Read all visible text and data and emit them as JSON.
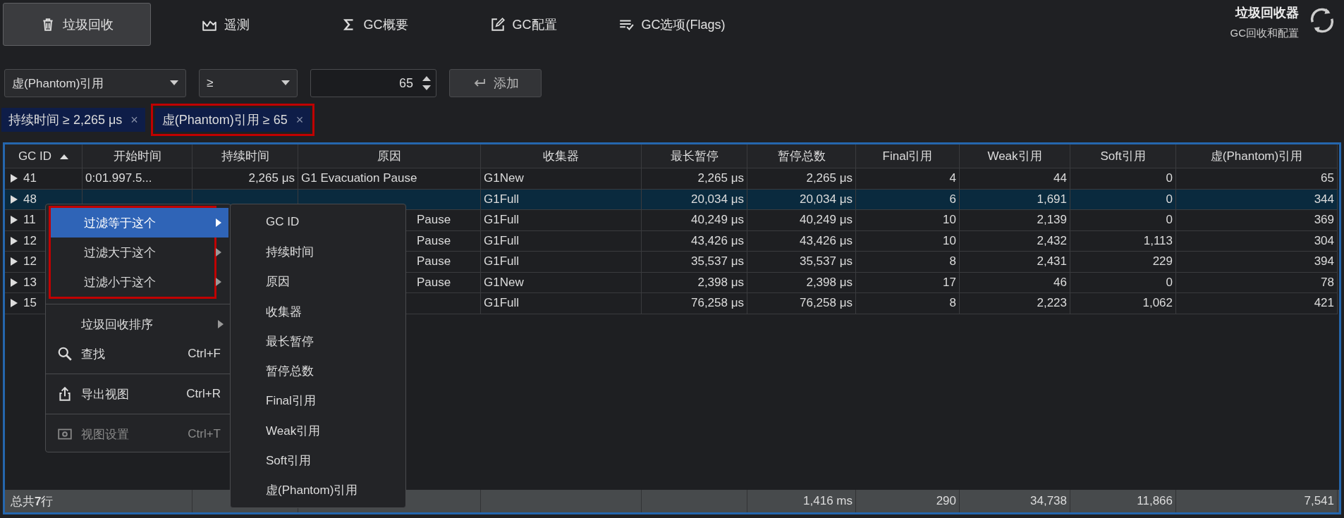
{
  "toolbar": {
    "tabs": [
      {
        "label": "垃圾回收",
        "selected": true
      },
      {
        "label": "遥测",
        "selected": false
      },
      {
        "label": "GC概要",
        "selected": false
      },
      {
        "label": "GC配置",
        "selected": false
      },
      {
        "label": "GC选项(Flags)",
        "selected": false
      }
    ],
    "title": "垃圾回收器",
    "subtitle": "GC回收和配置"
  },
  "filter": {
    "field": "虚(Phantom)引用",
    "operator": "≥",
    "value": "65",
    "add_button": "添加"
  },
  "chips": [
    {
      "label": "持续时间 ≥ 2,265 μs",
      "remove": "×",
      "annotated": false
    },
    {
      "label": "虚(Phantom)引用 ≥ 65",
      "remove": "×",
      "annotated": true
    }
  ],
  "table": {
    "columns": [
      "GC ID",
      "开始时间",
      "持续时间",
      "原因",
      "收集器",
      "最长暂停",
      "暂停总数",
      "Final引用",
      "Weak引用",
      "Soft引用",
      "虚(Phantom)引用"
    ],
    "rows": [
      {
        "selected": false,
        "reason_clipped": false,
        "cells": [
          "41",
          "0:01.997.5...",
          "2,265 μs",
          "G1 Evacuation Pause",
          "G1New",
          "2,265 μs",
          "2,265 μs",
          "4",
          "44",
          "0",
          "65"
        ]
      },
      {
        "selected": true,
        "reason_clipped": false,
        "cells": [
          "48",
          null,
          null,
          null,
          "G1Full",
          "20,034 μs",
          "20,034 μs",
          "6",
          "1,691",
          "0",
          "344"
        ]
      },
      {
        "selected": false,
        "reason_clipped": true,
        "cells": [
          "11",
          null,
          null,
          "Pause",
          "G1Full",
          "40,249 μs",
          "40,249 μs",
          "10",
          "2,139",
          "0",
          "369"
        ]
      },
      {
        "selected": false,
        "reason_clipped": true,
        "cells": [
          "12",
          null,
          null,
          "Pause",
          "G1Full",
          "43,426 μs",
          "43,426 μs",
          "10",
          "2,432",
          "1,113",
          "304"
        ]
      },
      {
        "selected": false,
        "reason_clipped": true,
        "cells": [
          "12",
          null,
          null,
          "Pause",
          "G1Full",
          "35,537 μs",
          "35,537 μs",
          "8",
          "2,431",
          "229",
          "394"
        ]
      },
      {
        "selected": false,
        "reason_clipped": true,
        "cells": [
          "13",
          null,
          null,
          "Pause",
          "G1New",
          "2,398 μs",
          "2,398 μs",
          "17",
          "46",
          "0",
          "78"
        ]
      },
      {
        "selected": false,
        "cells": [
          "15",
          null,
          null,
          null,
          "G1Full",
          "76,258 μs",
          "76,258 μs",
          "8",
          "2,223",
          "1,062",
          "421"
        ]
      }
    ],
    "footer": {
      "total": "总共**7**行",
      "cells": [
        null,
        null,
        null,
        null,
        "1,416 ms",
        "290",
        "34,738",
        "11,866",
        "7,541"
      ]
    }
  },
  "context_menu": {
    "groups": [
      {
        "annotated": true,
        "items": [
          {
            "kind": "submenu",
            "label": "过滤等于这个",
            "selected": true,
            "disabled": false
          },
          {
            "kind": "submenu",
            "label": "过滤大于这个",
            "selected": false,
            "disabled": false
          },
          {
            "kind": "submenu",
            "label": "过滤小于这个",
            "selected": false,
            "disabled": false
          }
        ]
      },
      {
        "annotated": false,
        "items": [
          {
            "kind": "submenu",
            "label": "垃圾回收排序",
            "selected": false,
            "disabled": false
          },
          {
            "kind": "command",
            "label": "查找",
            "shortcut": "Ctrl+F",
            "selected": false,
            "disabled": false
          }
        ]
      },
      {
        "annotated": false,
        "items": [
          {
            "kind": "command",
            "label": "导出视图",
            "shortcut": "Ctrl+R",
            "selected": false,
            "disabled": false
          }
        ]
      },
      {
        "annotated": false,
        "items": [
          {
            "kind": "command",
            "label": "视图设置",
            "shortcut": "Ctrl+T",
            "selected": false,
            "disabled": true
          }
        ]
      }
    ],
    "submenu": [
      "GC ID",
      "持续时间",
      "原因",
      "收集器",
      "最长暂停",
      "暂停总数",
      "Final引用",
      "Weak引用",
      "Soft引用",
      "虚(Phantom)引用"
    ]
  }
}
